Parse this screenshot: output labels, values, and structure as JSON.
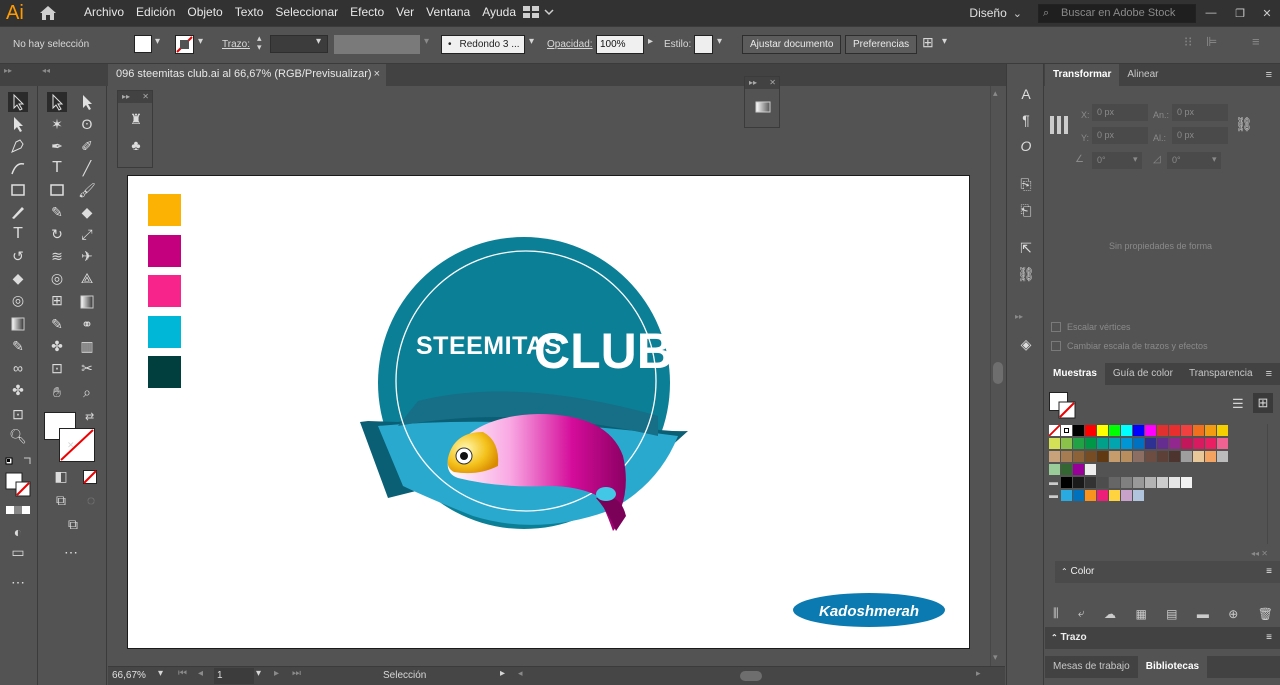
{
  "app": {
    "logo": "Ai",
    "workspace": "Diseño",
    "search_placeholder": "Buscar en Adobe Stock"
  },
  "menu": [
    "Archivo",
    "Edición",
    "Objeto",
    "Texto",
    "Seleccionar",
    "Efecto",
    "Ver",
    "Ventana",
    "Ayuda"
  ],
  "control": {
    "selection": "No hay selección",
    "stroke_label": "Trazo:",
    "brush": "Redondo 3 ...",
    "opacity_label": "Opacidad:",
    "opacity_value": "100%",
    "style_label": "Estilo:",
    "fit_button": "Ajustar documento",
    "prefs_button": "Preferencias"
  },
  "document_tab": {
    "title": "096 steemitas club.ai al 66,67% (RGB/Previsualizar)"
  },
  "artwork": {
    "title_left": "STEEMITAS",
    "title_right": "CLUB",
    "signature": "Kadoshmerah"
  },
  "palette_colors": [
    "#fbb203",
    "#c5007f",
    "#f7248c",
    "#00b7d8",
    "#013e3e"
  ],
  "status": {
    "zoom": "66,67%",
    "page": "1",
    "tool": "Selección"
  },
  "panels": {
    "transform_tab": "Transformar",
    "align_tab": "Alinear",
    "x_label": "X:",
    "y_label": "Y:",
    "w_label": "An.:",
    "h_label": "Al.:",
    "x_value": "0 px",
    "y_value": "0 px",
    "w_value": "0 px",
    "h_value": "0 px",
    "rot_value": "0°",
    "shear_value": "0°",
    "no_props": "Sin propiedades de forma",
    "scale_corners": "Escalar vértices",
    "scale_strokes": "Cambiar escala de trazos y efectos",
    "swatches_tab": "Muestras",
    "color_guide_tab": "Guía de color",
    "transparency_tab": "Transparencia",
    "color_panel": "Color",
    "stroke_panel": "Trazo",
    "artboards_tab": "Mesas de trabajo",
    "libraries_tab": "Bibliotecas"
  },
  "swatch_rows": [
    [
      "#ffffff",
      "#ffffff",
      "#000000",
      "#ff0000",
      "#ffff00",
      "#00ff00",
      "#00ffff",
      "#0000ff",
      "#ff00ff",
      "#e03030",
      "#e82e2e",
      "#f04040",
      "#f07020",
      "#f39c12",
      "#f5d000"
    ],
    [
      "#d4e157",
      "#8bc34a",
      "#21a345",
      "#009846",
      "#00a08a",
      "#00a5b0",
      "#0096d6",
      "#0070c0",
      "#2e3192",
      "#662d91",
      "#92278f",
      "#c2185b",
      "#d81b60",
      "#e91e63",
      "#f06292"
    ],
    [
      "#c8a27a",
      "#a67c52",
      "#8c6239",
      "#754c24",
      "#603913",
      "#c69c6d",
      "#b98e5e",
      "#8d6e63",
      "#6d4c41",
      "#5d4037",
      "#4e342e",
      "#9e9e9e",
      "#e8c898",
      "#f4a460",
      "#bcbcbc"
    ],
    [
      "#99cc99",
      "#336633",
      "#990099",
      "#eeeeee"
    ],
    [
      "#000000",
      "#1a1a1a",
      "#333333",
      "#4d4d4d",
      "#666666",
      "#808080",
      "#999999",
      "#b3b3b3",
      "#cccccc",
      "#e6e6e6",
      "#f2f2f2"
    ],
    [
      "#29abe2",
      "#0071bc",
      "#f7931e",
      "#ed1e79",
      "#ffd23f",
      "#c8a2c8",
      "#b0c4de"
    ]
  ]
}
